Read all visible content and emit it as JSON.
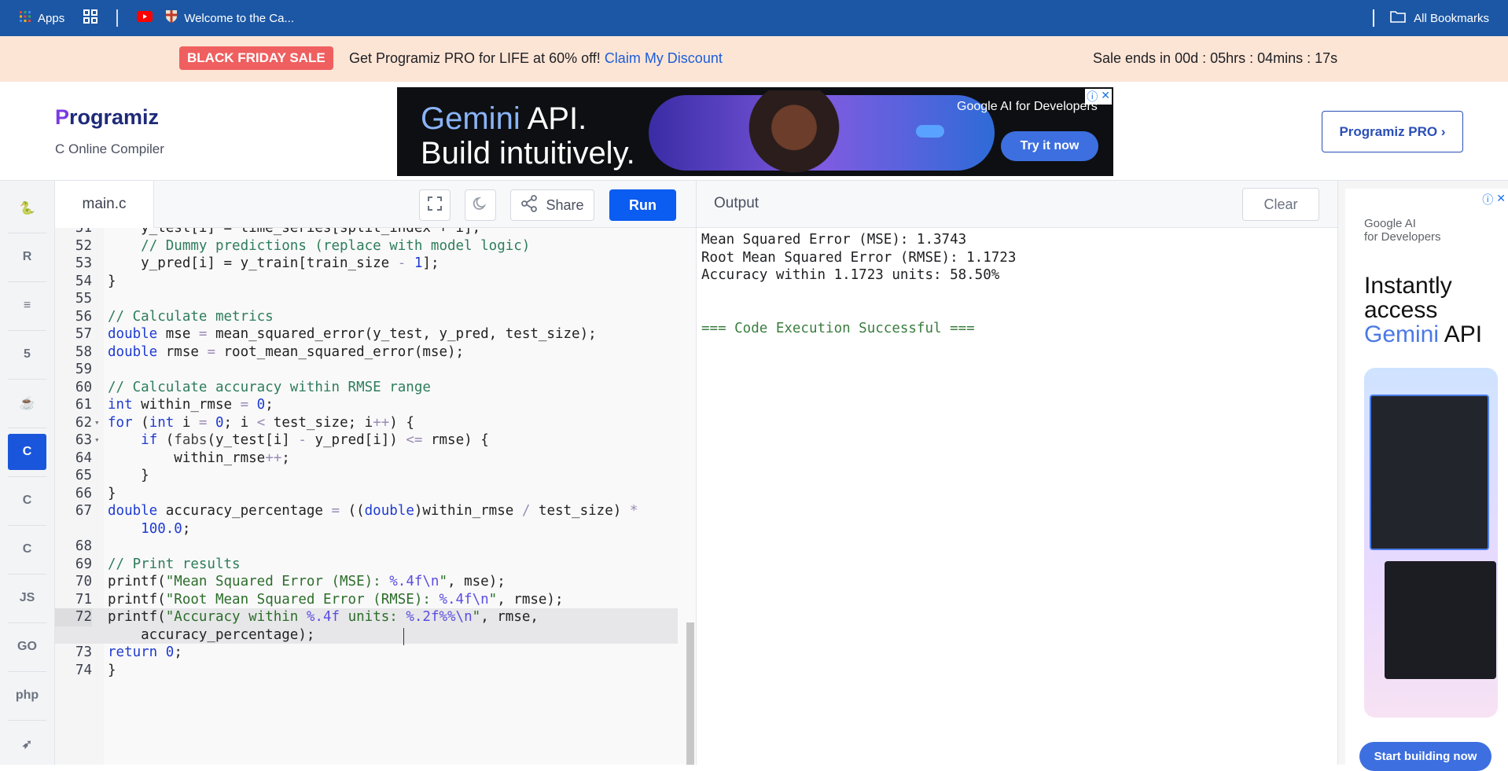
{
  "bookmarks": {
    "apps_label": "Apps",
    "tab_label": "Welcome to the Ca...",
    "all_bookmarks": "All Bookmarks"
  },
  "promo": {
    "badge": "BLACK FRIDAY SALE",
    "message": "Get Programiz PRO for LIFE at 60% off!",
    "link": "Claim My Discount",
    "timer": "Sale ends in 00d : 05hrs : 04mins : 17s"
  },
  "header": {
    "logo": "rogramiz",
    "logo_p": "P",
    "subtitle": "C Online Compiler",
    "pro_button": "Programiz PRO ›"
  },
  "ad_top": {
    "line1_brand": "Gemini",
    "line1_rest": " API.",
    "line2": "Build intuitively.",
    "sponsor": "Google AI for Developers",
    "cta": "Try it now"
  },
  "languages": [
    {
      "name": "python",
      "glyph": "🐍",
      "active": false
    },
    {
      "name": "r",
      "glyph": "R",
      "active": false
    },
    {
      "name": "sql",
      "glyph": "≡",
      "active": false
    },
    {
      "name": "html",
      "glyph": "5",
      "active": false
    },
    {
      "name": "java",
      "glyph": "☕",
      "active": false
    },
    {
      "name": "c",
      "glyph": "C",
      "active": true
    },
    {
      "name": "cpp",
      "glyph": "C",
      "active": false
    },
    {
      "name": "csharp",
      "glyph": "C",
      "active": false
    },
    {
      "name": "js",
      "glyph": "JS",
      "active": false
    },
    {
      "name": "go",
      "glyph": "GO",
      "active": false
    },
    {
      "name": "php",
      "glyph": "php",
      "active": false
    },
    {
      "name": "swift",
      "glyph": "➶",
      "active": false
    }
  ],
  "editor": {
    "file_tab": "main.c",
    "share_label": "Share",
    "run_label": "Run",
    "lines": [
      {
        "n": "51",
        "fold": "",
        "html": "    y_test[i] = time_series[split_index + i];"
      },
      {
        "n": "52",
        "fold": "",
        "html": "    <span class=\"cmt\">// Dummy predictions (replace with model logic)</span>"
      },
      {
        "n": "53",
        "fold": "",
        "html": "    y_pred[i] = y_train[train_size <span class=\"op\">-</span> <span class=\"num-l\">1</span>];"
      },
      {
        "n": "54",
        "fold": "",
        "html": "}"
      },
      {
        "n": "55",
        "fold": "",
        "html": ""
      },
      {
        "n": "56",
        "fold": "",
        "html": "<span class=\"cmt\">// Calculate metrics</span>"
      },
      {
        "n": "57",
        "fold": "",
        "html": "<span class=\"kw\">double</span> mse <span class=\"op\">=</span> mean_squared_error(y_test, y_pred, test_size);"
      },
      {
        "n": "58",
        "fold": "",
        "html": "<span class=\"kw\">double</span> rmse <span class=\"op\">=</span> root_mean_squared_error(mse);"
      },
      {
        "n": "59",
        "fold": "",
        "html": ""
      },
      {
        "n": "60",
        "fold": "",
        "html": "<span class=\"cmt\">// Calculate accuracy within RMSE range</span>"
      },
      {
        "n": "61",
        "fold": "",
        "html": "<span class=\"kw\">int</span> within_rmse <span class=\"op\">=</span> <span class=\"num-l\">0</span>;"
      },
      {
        "n": "62",
        "fold": "▾",
        "html": "<span class=\"kw\">for</span> (<span class=\"kw\">int</span> i <span class=\"op\">=</span> <span class=\"num-l\">0</span>; i <span class=\"op\">&lt;</span> test_size; i<span class=\"op\">++</span>) {"
      },
      {
        "n": "63",
        "fold": "▾",
        "html": "    <span class=\"kw\">if</span> (<span class=\"fn\">fabs</span>(y_test[i] <span class=\"op\">-</span> y_pred[i]) <span class=\"op\">&lt;=</span> rmse) {"
      },
      {
        "n": "64",
        "fold": "",
        "html": "        within_rmse<span class=\"op\">++</span>;"
      },
      {
        "n": "65",
        "fold": "",
        "html": "    }"
      },
      {
        "n": "66",
        "fold": "",
        "html": "}"
      },
      {
        "n": "67",
        "fold": "",
        "html": "<span class=\"kw\">double</span> accuracy_percentage <span class=\"op\">=</span> ((<span class=\"kw\">double</span>)within_rmse <span class=\"op\">/</span> test_size) <span class=\"op\">*</span>"
      },
      {
        "n": "",
        "fold": "",
        "html": "    <span class=\"num-l\">100.0</span>;"
      },
      {
        "n": "68",
        "fold": "",
        "html": ""
      },
      {
        "n": "69",
        "fold": "",
        "html": "<span class=\"cmt\">// Print results</span>"
      },
      {
        "n": "70",
        "fold": "",
        "html": "printf(<span class=\"str\">\"Mean Squared Error (MSE): </span><span class=\"esc\">%.4f\\n</span><span class=\"str\">\"</span>, mse);"
      },
      {
        "n": "71",
        "fold": "",
        "html": "printf(<span class=\"str\">\"Root Mean Squared Error (RMSE): </span><span class=\"esc\">%.4f\\n</span><span class=\"str\">\"</span>, rmse);"
      },
      {
        "n": "72",
        "fold": "",
        "html": "printf(<span class=\"str\">\"Accuracy within </span><span class=\"esc\">%.4f</span><span class=\"str\"> units: </span><span class=\"esc\">%.2f%%\\n</span><span class=\"str\">\"</span>, rmse,",
        "hl": true
      },
      {
        "n": "",
        "fold": "",
        "html": "    accuracy_percentage);",
        "hl": true
      },
      {
        "n": "73",
        "fold": "",
        "html": "<span class=\"kw\">return</span> <span class=\"num-l\">0</span>;"
      },
      {
        "n": "74",
        "fold": "",
        "html": "}"
      }
    ]
  },
  "output": {
    "title": "Output",
    "clear_label": "Clear",
    "lines": [
      "Mean Squared Error (MSE): 1.3743",
      "Root Mean Squared Error (RMSE): 1.1723",
      "Accuracy within 1.1723 units: 58.50%",
      "",
      "",
      "=== Code Execution Successful ==="
    ]
  },
  "ad_right": {
    "sponsor_line1": "Google AI",
    "sponsor_line2": "for Developers",
    "headline1": "Instantly",
    "headline2": "access",
    "headline3_brand": "Gemini",
    "headline3_rest": " API",
    "cta": "Start building now"
  },
  "colors": {
    "bookmark_bar": "#1c57a5",
    "promo_bg": "#fde5d6",
    "run_button": "#0b5cf0",
    "active_language": "#1a56db"
  }
}
